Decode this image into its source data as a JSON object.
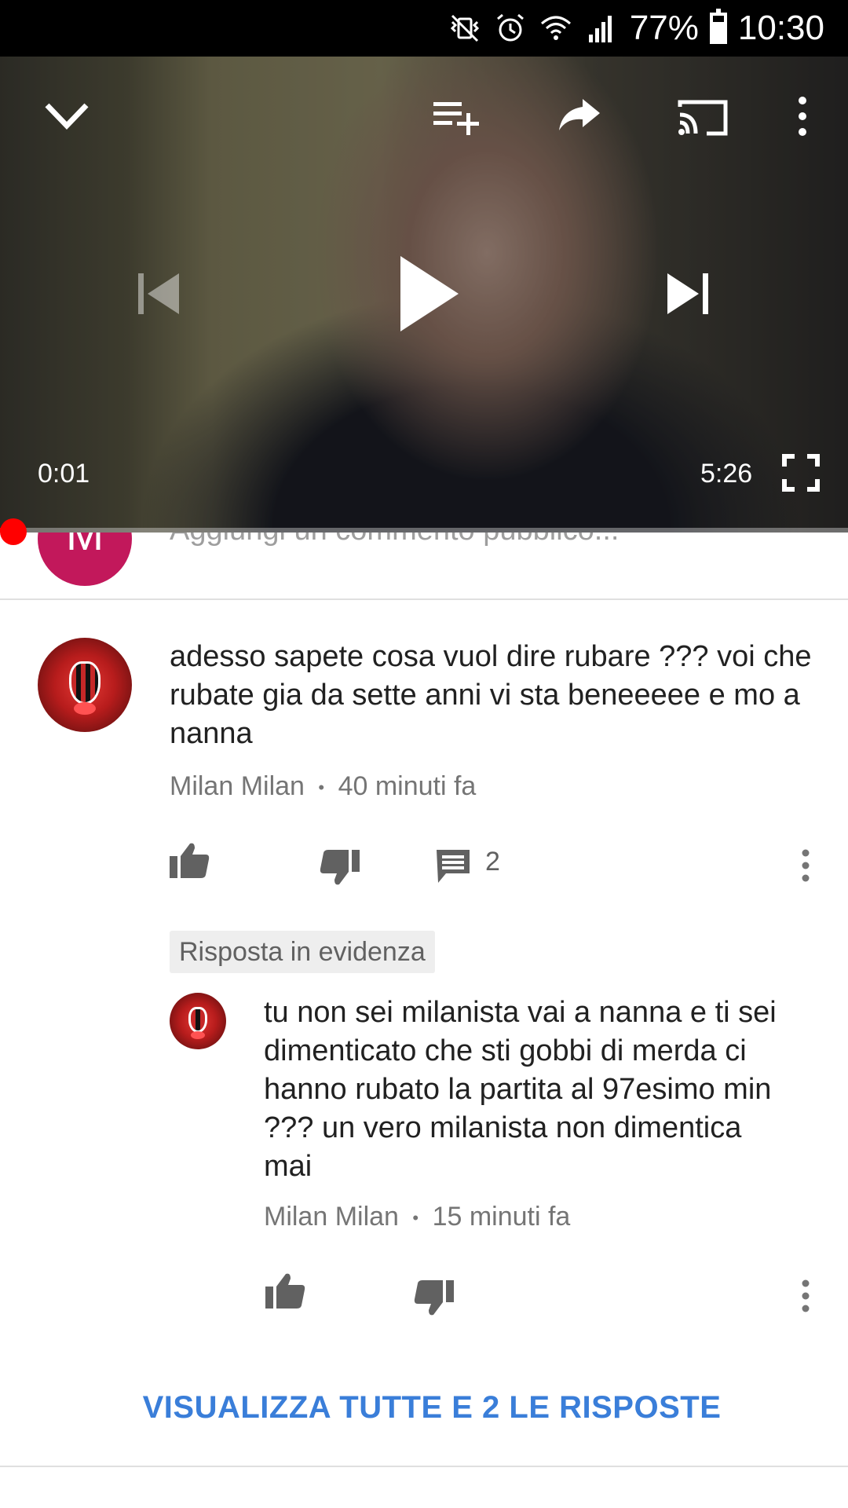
{
  "status_bar": {
    "battery": "77%",
    "time": "10:30",
    "icons": [
      "mute-vibrate-icon",
      "alarm-icon",
      "wifi-icon",
      "signal-icon",
      "battery-icon"
    ]
  },
  "player": {
    "current_time": "0:01",
    "duration": "5:26",
    "progress": 0.003,
    "icons": [
      "collapse-chevron-icon",
      "add-to-playlist-icon",
      "share-icon",
      "cast-icon",
      "more-vert-icon",
      "previous-icon",
      "play-icon",
      "next-icon",
      "fullscreen-icon"
    ]
  },
  "add_comment": {
    "avatar_letter": "M",
    "placeholder": "Aggiungi un commento pubblico..."
  },
  "comment": {
    "text": "adesso sapete cosa vuol dire rubare ??? voi che rubate gia da sette anni vi sta beneeeee e mo a nanna",
    "author": "Milan Milan",
    "separator": "•",
    "time": "40 minuti fa",
    "reply_count": "2"
  },
  "reply": {
    "badge": "Risposta in evidenza",
    "text": "tu non sei milanista vai a nanna e ti sei dimenticato che sti gobbi di merda ci hanno rubato la partita al 97esimo min ??? un vero milanista non dimentica mai",
    "author": "Milan Milan",
    "separator": "•",
    "time": "15 minuti fa"
  },
  "view_all_replies": "VISUALIZZA TUTTE E 2 LE RISPOSTE",
  "colors": {
    "accent_red": "#ff0000",
    "link_blue": "#3a7ed9",
    "avatar_magenta": "#c2185b"
  }
}
